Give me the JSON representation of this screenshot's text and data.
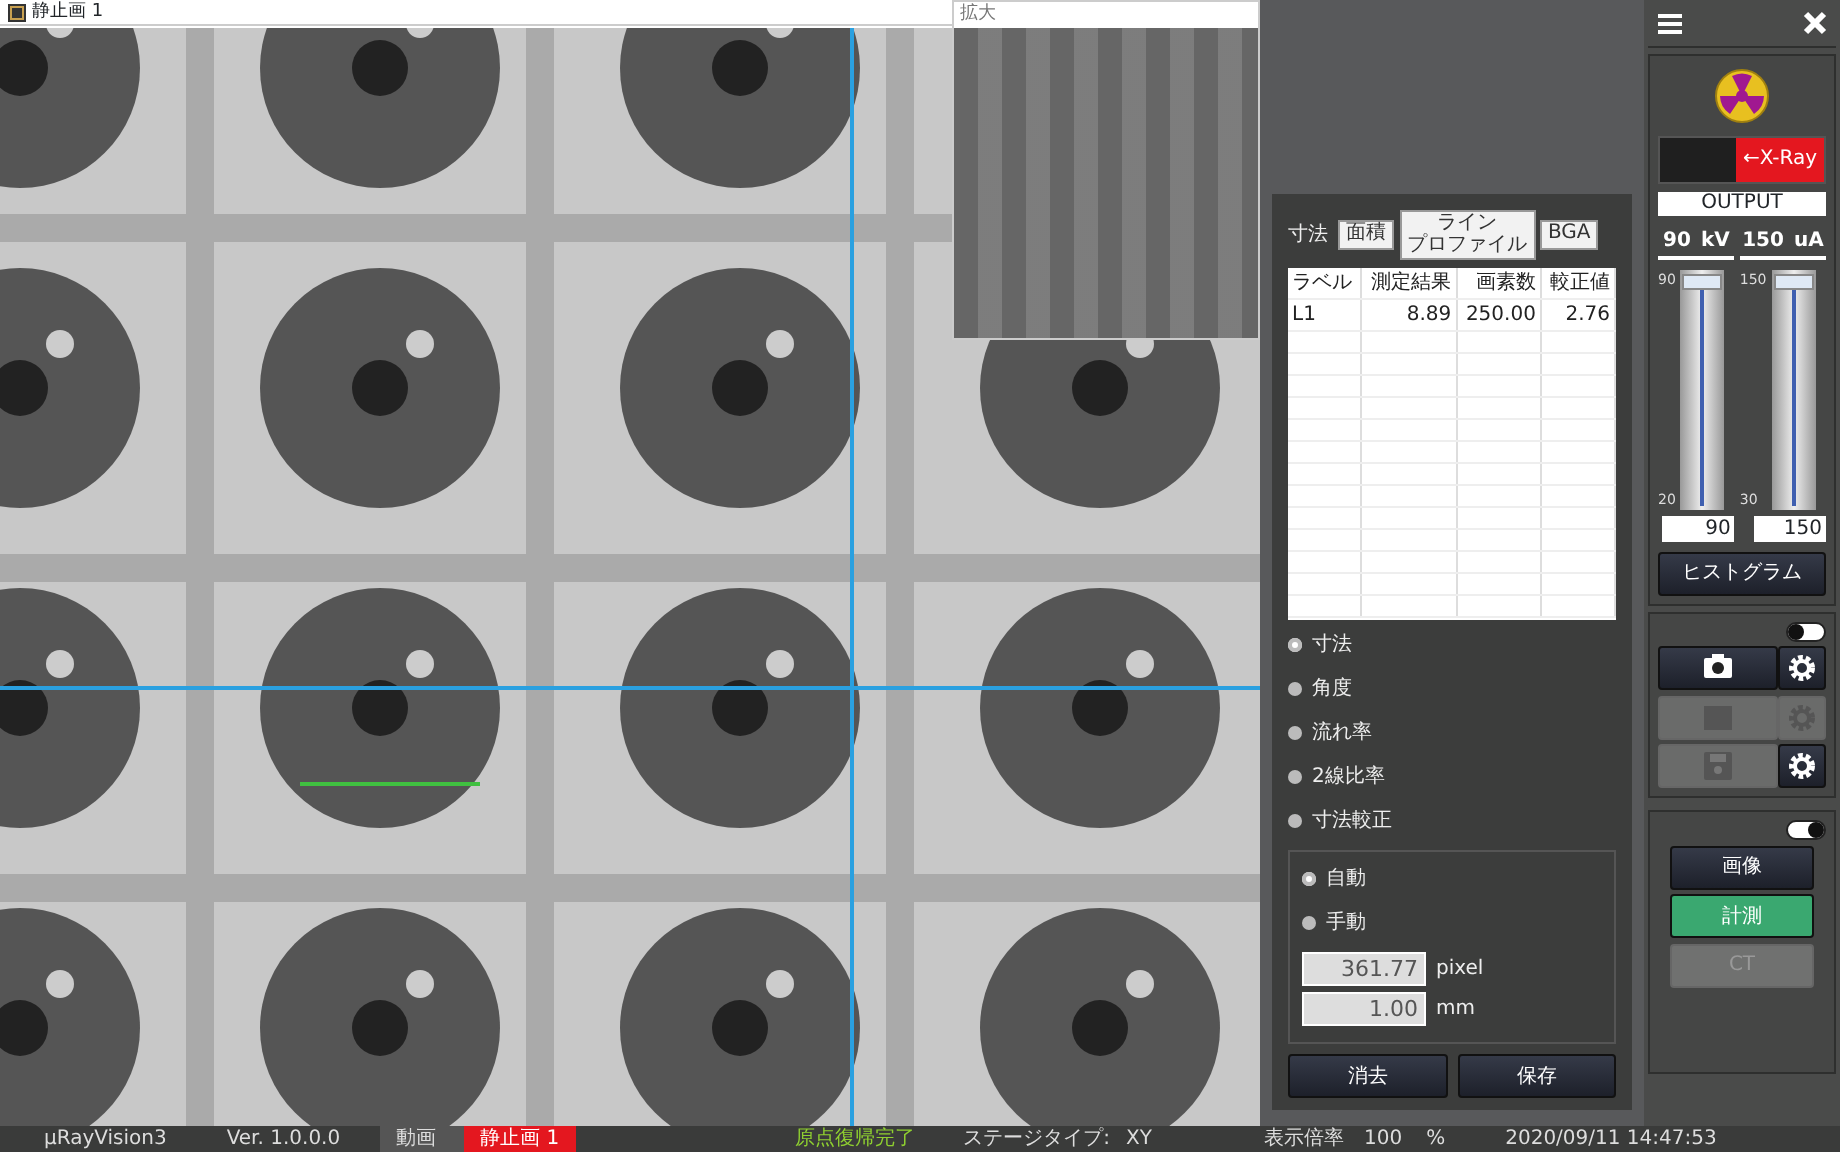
{
  "viewer": {
    "title": "静止画 1",
    "magnifier_title": "拡大"
  },
  "measure_panel": {
    "label": "寸法",
    "tabs": [
      {
        "label": "面積",
        "selected": false
      },
      {
        "lines": [
          "ライン",
          "プロファイル"
        ],
        "selected": false
      },
      {
        "label": "BGA",
        "selected": false
      }
    ],
    "table": {
      "columns": [
        "ラベル",
        "測定結果",
        "画素数",
        "較正値"
      ],
      "rows": [
        [
          "L1",
          "8.89",
          "250.00",
          "2.76"
        ]
      ]
    },
    "modes": [
      {
        "label": "寸法",
        "selected": true
      },
      {
        "label": "角度",
        "selected": false
      },
      {
        "label": "流れ率",
        "selected": false
      },
      {
        "label": "2線比率",
        "selected": false
      },
      {
        "label": "寸法較正",
        "selected": false
      }
    ],
    "calibration": {
      "options": [
        {
          "label": "自動",
          "selected": true
        },
        {
          "label": "手動",
          "selected": false
        }
      ],
      "fields": [
        {
          "value": "361.77",
          "unit": "pixel"
        },
        {
          "value": "1.00",
          "unit": "mm"
        }
      ]
    },
    "buttons": [
      "消去",
      "保存"
    ]
  },
  "xray": {
    "label": "←X-Ray",
    "output": "OUTPUT",
    "sliders": [
      {
        "value": "90",
        "unit": "kV",
        "max": "90",
        "min": "20",
        "level": 1,
        "input": "90"
      },
      {
        "value": "150",
        "unit": "uA",
        "max": "150",
        "min": "30",
        "level": 1,
        "input": "150"
      }
    ],
    "histogram": "ヒストグラム"
  },
  "capture": {
    "on": false,
    "rows": [
      {
        "kind": "camera",
        "disabled": false,
        "settings_disabled": false
      },
      {
        "kind": "movie",
        "disabled": true,
        "settings_disabled": true
      },
      {
        "kind": "save",
        "disabled": true,
        "settings_disabled": false
      }
    ]
  },
  "mode": {
    "on": true,
    "buttons": [
      {
        "label": "画像",
        "selected": false,
        "disabled": false
      },
      {
        "label": "計測",
        "selected": true,
        "disabled": false
      },
      {
        "label": "CT",
        "selected": false,
        "disabled": true
      }
    ]
  },
  "status_bar": {
    "app": "µRayVision3",
    "version": "Ver. 1.0.0.0",
    "tabs": [
      {
        "label": "動画",
        "selected": false
      },
      {
        "label": "静止画 1",
        "selected": true
      }
    ],
    "message": "原点復帰完了",
    "stage_label": "ステージタイプ:",
    "stage": "XY",
    "zoom_label": "表示倍率",
    "zoom": "100",
    "zoom_unit": "%",
    "datetime": "2020/09/11 14:47:53"
  }
}
